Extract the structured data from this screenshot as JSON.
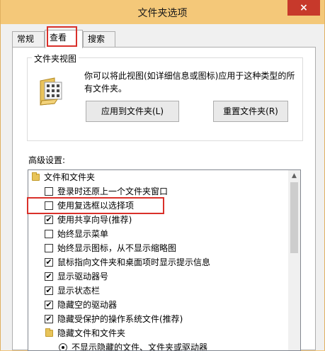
{
  "window": {
    "title": "文件夹选项",
    "close": "×"
  },
  "tabs": [
    {
      "label": "常规"
    },
    {
      "label": "查看"
    },
    {
      "label": "搜索"
    }
  ],
  "folder_views": {
    "legend": "文件夹视图",
    "description": "你可以将此视图(如详细信息或图标)应用于这种类型的所有文件夹。",
    "apply_button": "应用到文件夹(L)",
    "reset_button": "重置文件夹(R)"
  },
  "advanced": {
    "label": "高级设置:",
    "items": [
      {
        "type": "folder",
        "label": "文件和文件夹"
      },
      {
        "type": "checkbox",
        "checked": false,
        "label": "登录时还原上一个文件夹窗口"
      },
      {
        "type": "checkbox",
        "checked": false,
        "label": "使用复选框以选择项"
      },
      {
        "type": "checkbox",
        "checked": true,
        "label": "使用共享向导(推荐)"
      },
      {
        "type": "checkbox",
        "checked": false,
        "label": "始终显示菜单"
      },
      {
        "type": "checkbox",
        "checked": false,
        "label": "始终显示图标，从不显示缩略图"
      },
      {
        "type": "checkbox",
        "checked": true,
        "label": "鼠标指向文件夹和桌面项时显示提示信息"
      },
      {
        "type": "checkbox",
        "checked": true,
        "label": "显示驱动器号"
      },
      {
        "type": "checkbox",
        "checked": true,
        "label": "显示状态栏"
      },
      {
        "type": "checkbox",
        "checked": true,
        "label": "隐藏空的驱动器"
      },
      {
        "type": "checkbox",
        "checked": true,
        "label": "隐藏受保护的操作系统文件(推荐)"
      },
      {
        "type": "folder",
        "label": "隐藏文件和文件夹"
      },
      {
        "type": "radio",
        "checked": true,
        "label": "不显示隐藏的文件、文件夹或驱动器"
      }
    ]
  },
  "colors": {
    "titlebar": "#f4c879",
    "highlight": "#d9302a",
    "close": "#c7392b"
  }
}
